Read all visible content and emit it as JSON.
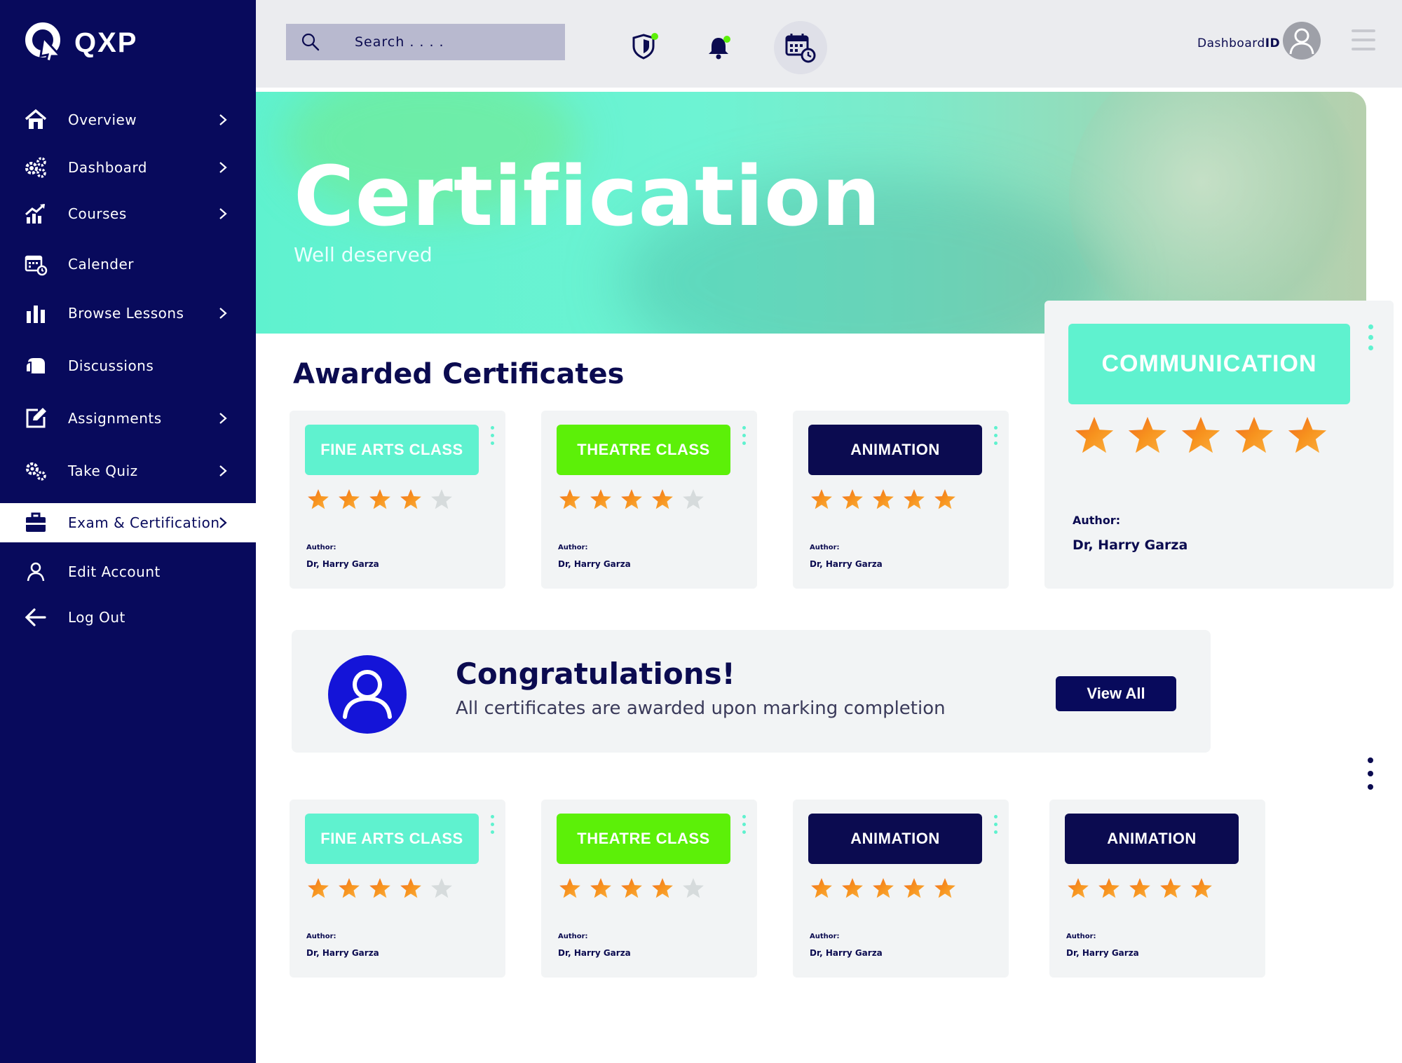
{
  "app": {
    "logo_text": "QXP"
  },
  "sidebar": {
    "items": [
      {
        "label": "Overview",
        "icon": "home-icon",
        "chevron": true
      },
      {
        "label": "Dashboard",
        "icon": "gears-icon",
        "chevron": true
      },
      {
        "label": "Courses",
        "icon": "chart-icon",
        "chevron": true
      },
      {
        "label": "Calender",
        "icon": "calendar-icon",
        "chevron": false
      },
      {
        "label": "Browse Lessons",
        "icon": "bars-icon",
        "chevron": true
      },
      {
        "label": "Discussions",
        "icon": "chat-icon",
        "chevron": false
      },
      {
        "label": "Assignments",
        "icon": "edit-icon",
        "chevron": true
      },
      {
        "label": "Take Quiz",
        "icon": "quiz-gears-icon",
        "chevron": true
      },
      {
        "label": "Exam & Certification",
        "icon": "briefcase-icon",
        "chevron": true,
        "active": true
      },
      {
        "label": "Edit Account",
        "icon": "user-icon",
        "chevron": false
      },
      {
        "label": "Log Out",
        "icon": "arrow-left-icon",
        "chevron": false
      }
    ]
  },
  "topbar": {
    "search_placeholder": "Search . . . .",
    "dashboard_prefix": "Dashboard",
    "dashboard_suffix": "ID"
  },
  "hero": {
    "title": "Certification",
    "subtitle": "Well deserved"
  },
  "awarded": {
    "title": "Awarded Certificates",
    "cards": [
      {
        "title": "FINE ARTS CLASS",
        "color": "teal",
        "rating": 4,
        "author_label": "Author:",
        "author": "Dr, Harry Garza"
      },
      {
        "title": "THEATRE CLASS",
        "color": "green",
        "rating": 4,
        "author_label": "Author:",
        "author": "Dr, Harry Garza"
      },
      {
        "title": "ANIMATION",
        "color": "navy",
        "rating": 5,
        "author_label": "Author:",
        "author": "Dr, Harry Garza"
      }
    ],
    "featured": {
      "title": "COMMUNICATION",
      "color": "teal",
      "rating": 5,
      "author_label": "Author:",
      "author": "Dr, Harry Garza"
    }
  },
  "congrats": {
    "title": "Congratulations!",
    "subtitle": "All certificates are awarded upon marking completion",
    "button": "View All"
  },
  "more_cards": [
    {
      "title": "FINE ARTS CLASS",
      "color": "teal",
      "rating": 4,
      "author_label": "Author:",
      "author": "Dr, Harry Garza"
    },
    {
      "title": "THEATRE CLASS",
      "color": "green",
      "rating": 4,
      "author_label": "Author:",
      "author": "Dr, Harry Garza"
    },
    {
      "title": "ANIMATION",
      "color": "navy",
      "rating": 5,
      "author_label": "Author:",
      "author": "Dr, Harry Garza"
    },
    {
      "title": "ANIMATION",
      "color": "navy",
      "rating": 5,
      "author_label": "Author:",
      "author": "Dr, Harry Garza"
    }
  ],
  "colors": {
    "sidebar": "#080a5c",
    "teal": "#5ff2cf",
    "green": "#5cf008",
    "navy": "#0b0b50",
    "star": "#f7931e",
    "star_empty": "#d6dbdc",
    "notification_dot": "#5cf008"
  }
}
